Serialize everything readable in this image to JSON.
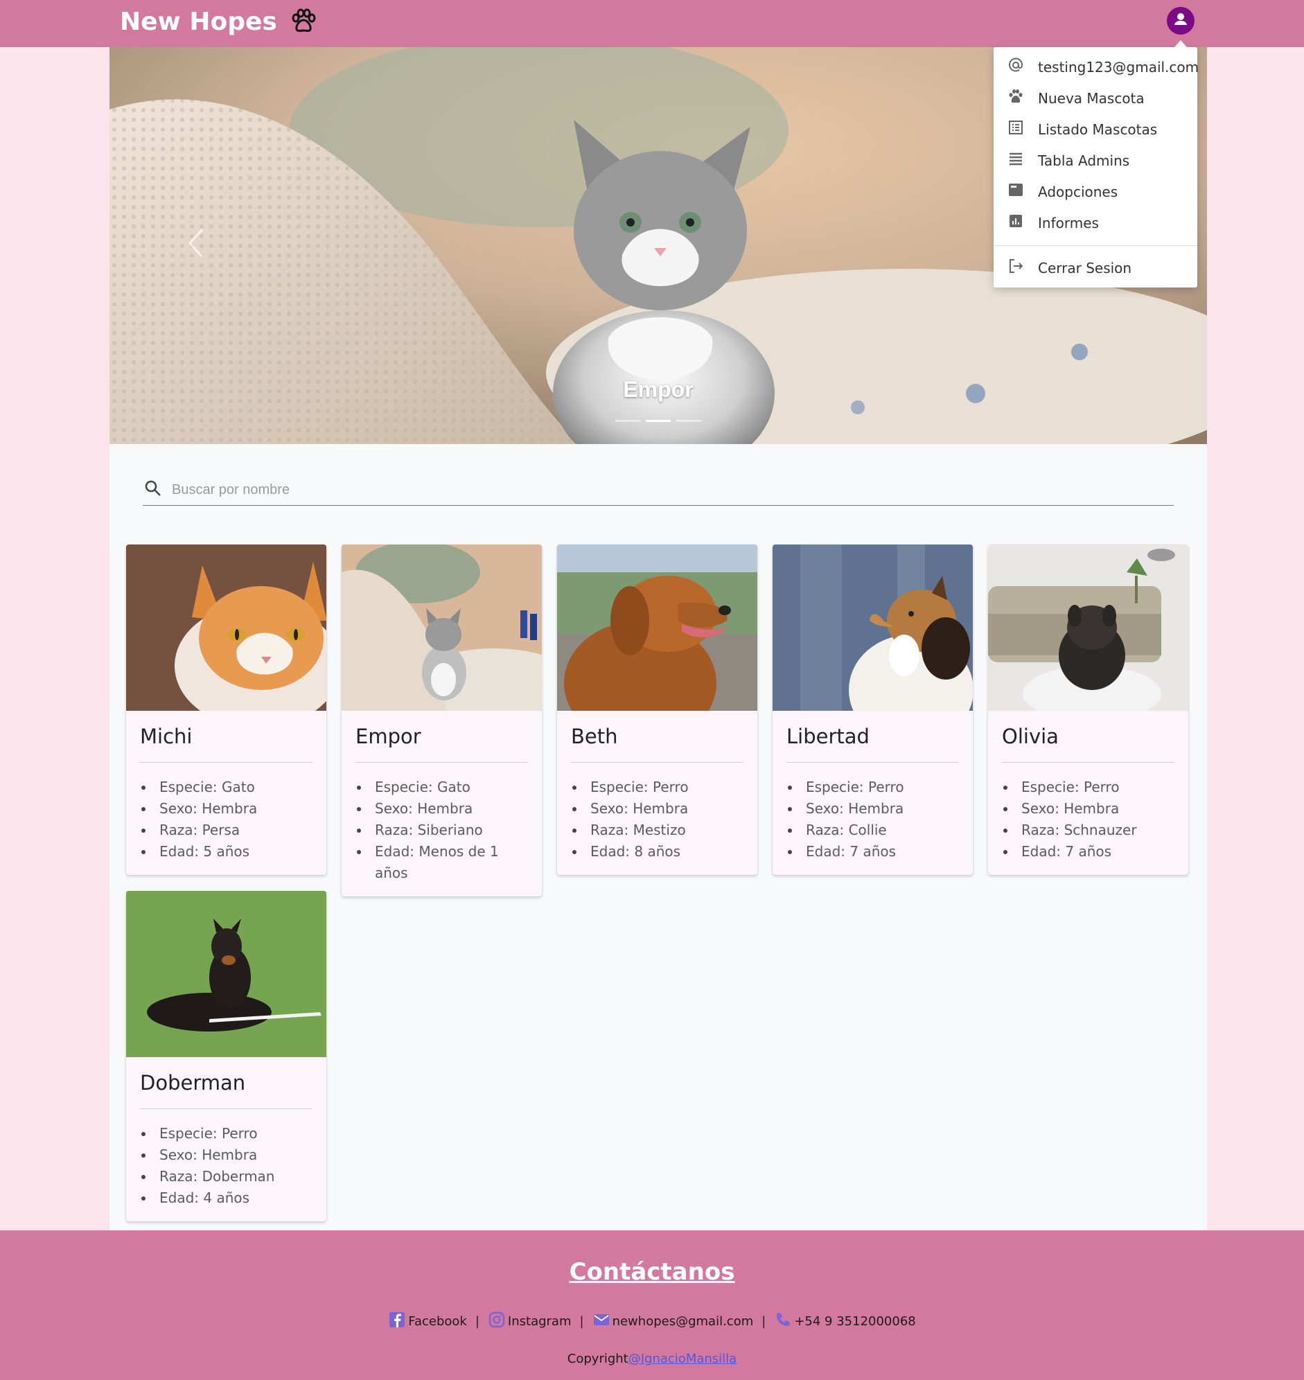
{
  "header": {
    "brand": "New Hopes",
    "brand_icon": "paw-icon",
    "user_icon": "account-circle-icon"
  },
  "carousel": {
    "caption": "Empor",
    "slide_count": 3,
    "active_slide": 2
  },
  "search": {
    "placeholder": "Buscar por nombre",
    "value": ""
  },
  "pets": [
    {
      "name": "Michi",
      "especie": "Especie: Gato",
      "sexo": "Sexo: Hembra",
      "raza": "Raza: Persa",
      "edad": "Edad: 5 años"
    },
    {
      "name": "Empor",
      "especie": "Especie: Gato",
      "sexo": "Sexo: Hembra",
      "raza": "Raza: Siberiano",
      "edad": "Edad: Menos de 1 años"
    },
    {
      "name": "Beth",
      "especie": "Especie: Perro",
      "sexo": "Sexo: Hembra",
      "raza": "Raza: Mestizo",
      "edad": "Edad: 8 años"
    },
    {
      "name": "Libertad",
      "especie": "Especie: Perro",
      "sexo": "Sexo: Hembra",
      "raza": "Raza: Collie",
      "edad": "Edad: 7 años"
    },
    {
      "name": "Olivia",
      "especie": "Especie: Perro",
      "sexo": "Sexo: Hembra",
      "raza": "Raza: Schnauzer",
      "edad": "Edad: 7 años"
    },
    {
      "name": "Doberman",
      "especie": "Especie: Perro",
      "sexo": "Sexo: Hembra",
      "raza": "Raza: Doberman",
      "edad": "Edad: 4 años"
    }
  ],
  "menu": {
    "email": "testing123@gmail.com",
    "items": [
      {
        "label": "Nueva Mascota",
        "icon": "paw-icon"
      },
      {
        "label": "Listado Mascotas",
        "icon": "list-icon"
      },
      {
        "label": "Tabla Admins",
        "icon": "table-icon"
      },
      {
        "label": "Adopciones",
        "icon": "card-icon"
      },
      {
        "label": "Informes",
        "icon": "chart-icon"
      }
    ],
    "logout": "Cerrar Sesion"
  },
  "footer": {
    "title": "Contáctanos",
    "facebook": "Facebook",
    "instagram": "Instagram",
    "email": "newhopes@gmail.com",
    "phone": "+54 9 3512000068",
    "separator": "|",
    "copyright": "Copyright",
    "author": "@IgnacioMansilla"
  },
  "colors": {
    "header_bg": "#d4799e",
    "page_bg": "#fde4ec",
    "avatar_bg": "#7b0a84",
    "icon_accent": "#8a5bd8"
  }
}
